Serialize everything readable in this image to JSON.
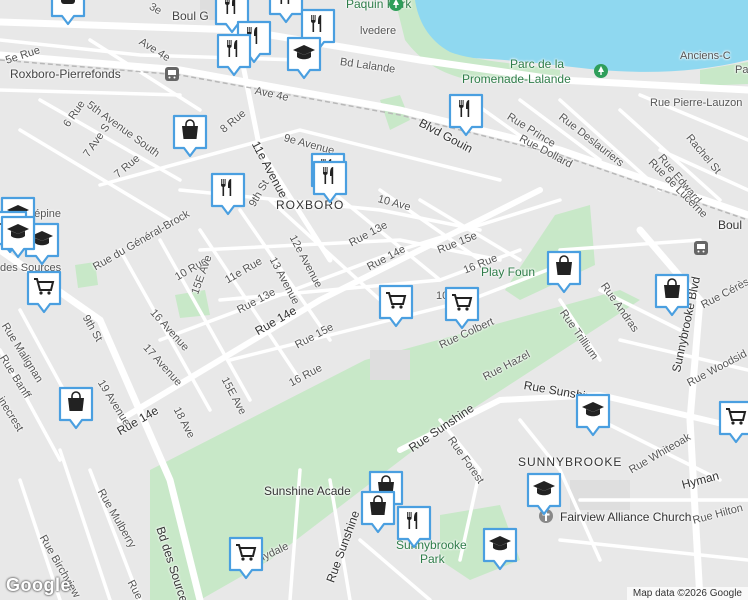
{
  "map": {
    "footer_text": "Map data ©2026 Google",
    "google_logo": "Google",
    "colors": {
      "water": "#8fd8f0",
      "park": "#c8e8c8",
      "land": "#e8e8e8",
      "road": "#ffffff",
      "marker": "#4a9fe0"
    }
  },
  "places": {
    "roxboro_pierrefonds": "Roxboro-Pierrefonds",
    "roxboro": "ROXBORO",
    "sunnybrooke": "SUNNYBROOKE",
    "paquin_park": "Paquin Park",
    "parc_promenade_1": "Parc de la",
    "parc_promenade_2": "Promenade-Lalande",
    "anciens_1": "Anciens-C",
    "anciens_2": "Pa",
    "play_fountain": "Play Foun",
    "sunshine_academy": "Sunshine Acade",
    "sunnybrooke_park_1": "Sunnybrooke",
    "sunnybrooke_park_2": "Park",
    "fairview_church": "Fairview Alliance Church"
  },
  "streets": {
    "boul_g": "Boul G",
    "bd_lalande": "Bd Lalande",
    "ave_4e_a": "Ave 4e",
    "ave_4e_b": "Ave 4e",
    "ave_5e_rue": "5e Rue",
    "fifth_ave_south": "5th Avenue South",
    "sixth_rue": "6 Rue",
    "seventh_ave_s": "7 Ave S",
    "seventh_rue": "7 Rue",
    "eighth_rue": "8 Rue",
    "ninth_avenue": "9e Avenue",
    "eleventh_avenue": "11e Avenue",
    "ninth_st": "9th St",
    "tenth_ave": "10 Ave",
    "thirteenth_e": "Rue 13e",
    "fourteenth_e": "Rue 14e",
    "fifteenth_e": "Rue 15e",
    "sixteenth_rue": "16 Rue",
    "twelfth_avenue": "12e Avenue",
    "thirteen_avenue": "13 Avenue",
    "tenth_rue": "10 Rue",
    "eleventh_rue": "11e Rue",
    "fifteenth_ave": "15E Ave",
    "thirteen_e_small": "Rue 13e",
    "sixteen_avenue": "16 Avenue",
    "seventeen_avenue": "17 Avenue",
    "rue_14e_big": "Rue 14e",
    "rue_15e": "Rue 15e",
    "sixteen_rue_b": "16 Rue",
    "fifteen_e_ave_b": "15E Ave",
    "eighteen_ave": "18 Ave",
    "nineteen_avenue": "19 Avenue",
    "ninth_st_b": "9th St",
    "rue_14e_low": "Rue 14e",
    "general_brock": "Rue du Général-Brock",
    "lepine": "Lépine",
    "roly": "oly",
    "des_sources": "des Sources",
    "malignan": "Rue Malignan",
    "banff": "Rue Banff",
    "pinecrest": "inecrest",
    "bd_des_sources": "Bd des Sources",
    "mulberry": "Rue Mulberry",
    "birchview": "Rue Birchview",
    "rue_d": "Rue d",
    "glydale": "lydale",
    "rue_sunshine_a": "Rue Sunshine",
    "rue_sunshine_b": "Rue Sunshine",
    "rue_sunshine_c": "Rue Sunshine",
    "rue_forest": "Rue Forest",
    "rue_hazel": "Rue Hazel",
    "rue_colbert": "Rue Colbert",
    "ten_r": "10",
    "rue_trillium": "Rue Trillium",
    "rue_andras": "Rue Andras",
    "sunnybrooke_blvd": "Sunnybrooke Blvd",
    "rue_ceres": "Rue Cérès",
    "rue_woodside": "Rue Woodsid",
    "rue_whiteoak": "Rue Whiteoak",
    "hyman": "Hyman",
    "rue_hilton": "Rue Hilton",
    "boul_right": "Boul",
    "blvd_gouin": "Blvd Gouin",
    "rue_prince": "Rue Prince",
    "rue_dollard": "Rue Dollard",
    "rue_deslauriers": "Rue Deslauriers",
    "rue_pierre_lauzon": "Rue Pierre-Lauzon",
    "rachel_st": "Rachel St",
    "rue_edward": "Rue Edward",
    "rue_de_lucerne": "Rue de Lucerne",
    "alvedere": "lvedere",
    "ave_6e": "Ave 6e",
    "se": "3e"
  },
  "markers": [
    {
      "name": "transit-marker",
      "icon": "transit-icon"
    },
    {
      "name": "restaurant-marker-1",
      "icon": "restaurant-icon"
    },
    {
      "name": "shopping-marker-1",
      "icon": "shopping-icon"
    },
    {
      "name": "restaurant-marker-2",
      "icon": "restaurant-icon"
    },
    {
      "name": "school-marker-1",
      "icon": "school-icon"
    }
  ]
}
